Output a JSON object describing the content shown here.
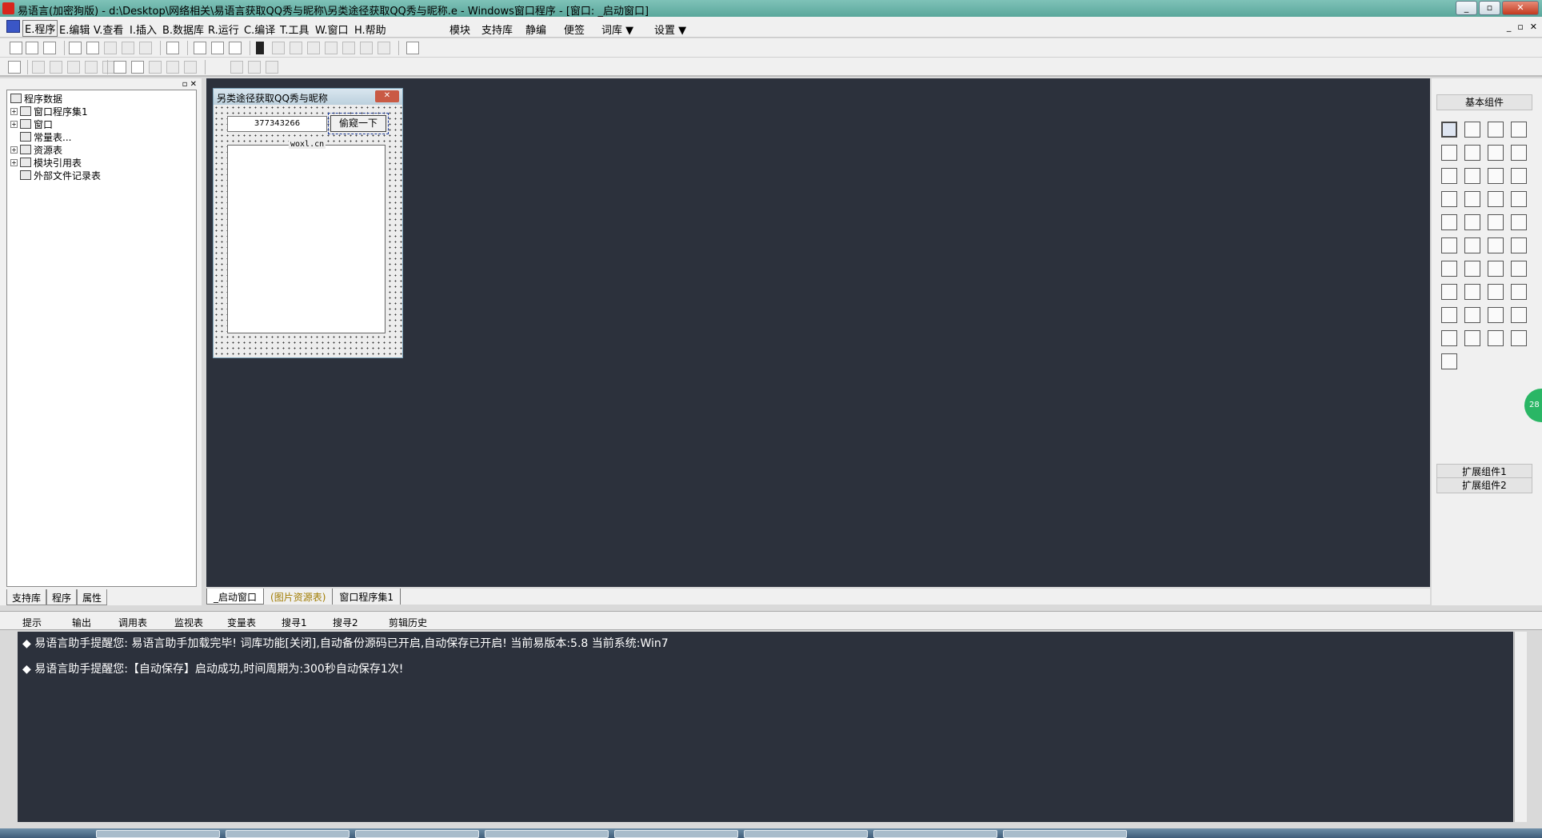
{
  "window": {
    "title": "易语言(加密狗版) - d:\\Desktop\\网络相关\\易语言获取QQ秀与昵称\\另类途径获取QQ秀与昵称.e - Windows窗口程序 - [窗口: _启动窗口]"
  },
  "menu": {
    "items": [
      "E.程序",
      "E.编辑",
      "V.查看",
      "I.插入",
      "B.数据库",
      "R.运行",
      "C.编译",
      "T.工具",
      "W.窗口",
      "H.帮助"
    ],
    "extra": [
      "模块",
      "支持库",
      "静编",
      "便签",
      "词库 ▼",
      "设置 ▼"
    ]
  },
  "tree": {
    "root": "程序数据",
    "items": [
      "窗口程序集1",
      "窗口",
      "常量表...",
      "资源表",
      "模块引用表",
      "外部文件记录表"
    ]
  },
  "left_tabs": [
    "支持库",
    "程序",
    "属性"
  ],
  "design": {
    "window_title": "另类途径获取QQ秀与昵称",
    "close_glyph": "✕",
    "qq_input_value": "377343266",
    "button_label": "偷窥一下",
    "group_label": "woxl.cn"
  },
  "designer_tabs": [
    "_启动窗口",
    "(图片资源表)",
    "窗口程序集1"
  ],
  "right_panel": {
    "header": "基本组件",
    "ext1": "扩展组件1",
    "ext2": "扩展组件2",
    "badge": "28"
  },
  "bottom_tabs": [
    "提示",
    "输出",
    "调用表",
    "监视表",
    "变量表",
    "搜寻1",
    "搜寻2",
    "剪辑历史"
  ],
  "output": {
    "lines": [
      "◆ 易语言助手提醒您:  易语言助手加载完毕!  词库功能[关闭],自动备份源码已开启,自动保存已开启!  当前易版本:5.8  当前系统:Win7",
      "◆ 易语言助手提醒您:【自动保存】启动成功,时间周期为:300秒自动保存1次!"
    ]
  }
}
